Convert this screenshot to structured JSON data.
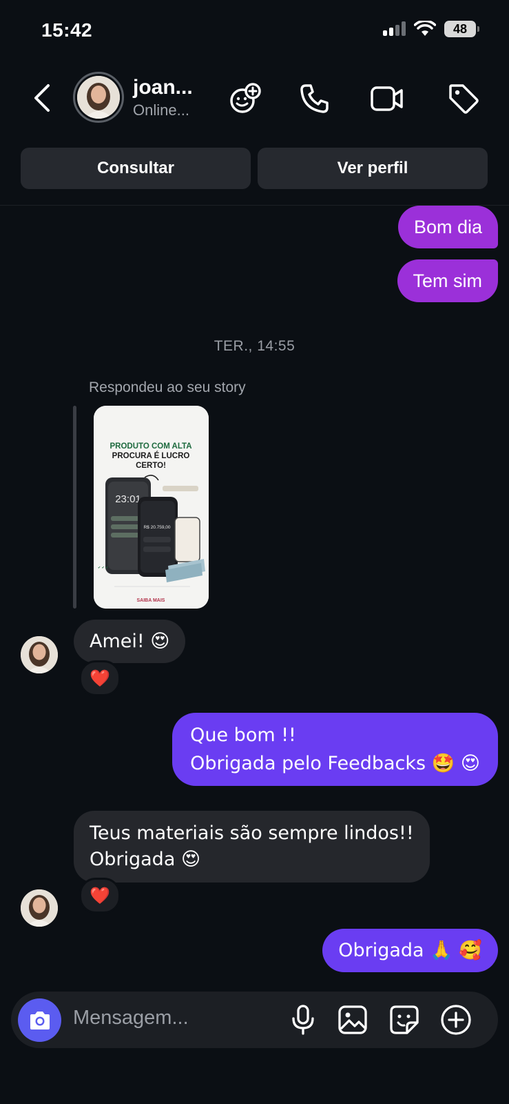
{
  "status_bar": {
    "time": "15:42",
    "battery": "48"
  },
  "header": {
    "contact_name": "joan...",
    "contact_status": "Online...",
    "icons": [
      "back-icon",
      "effects-icon",
      "phone-icon",
      "video-icon",
      "tag-icon"
    ]
  },
  "actions": {
    "consult_label": "Consultar",
    "profile_label": "Ver perfil"
  },
  "messages": {
    "m1": "Bom dia",
    "m2": "Tem sim",
    "timestamp": "TER., 14:55",
    "reply_label": "Respondeu ao seu story",
    "story": {
      "title_line1": "PRODUTO COM ALTA",
      "title_line2": "PROCURA É LUCRO",
      "title_line3": "CERTO!",
      "clock": "23:01",
      "value": "R$ 20.759,00",
      "footer": "SAIBA MAIS"
    },
    "m3": "Amei! 😍",
    "m3_reaction": "❤️",
    "m4_line1": "Que bom !!",
    "m4_line2": "Obrigada pelo Feedbacks 🤩 😍",
    "m5_line1": "Teus materiais são sempre lindos!!",
    "m5_line2": "Obrigada 😍",
    "m5_reaction": "❤️",
    "m6": "Obrigada 🙏 🥰"
  },
  "composer": {
    "placeholder": "Mensagem...",
    "icons": [
      "camera-icon",
      "microphone-icon",
      "image-icon",
      "sticker-icon",
      "plus-circle-icon"
    ]
  },
  "colors": {
    "background": "#0b0f14",
    "sent_purple": "#9b30d9",
    "sent_violet": "#6a3df2",
    "received": "#25272c",
    "camera_button": "#5b5cf0"
  }
}
